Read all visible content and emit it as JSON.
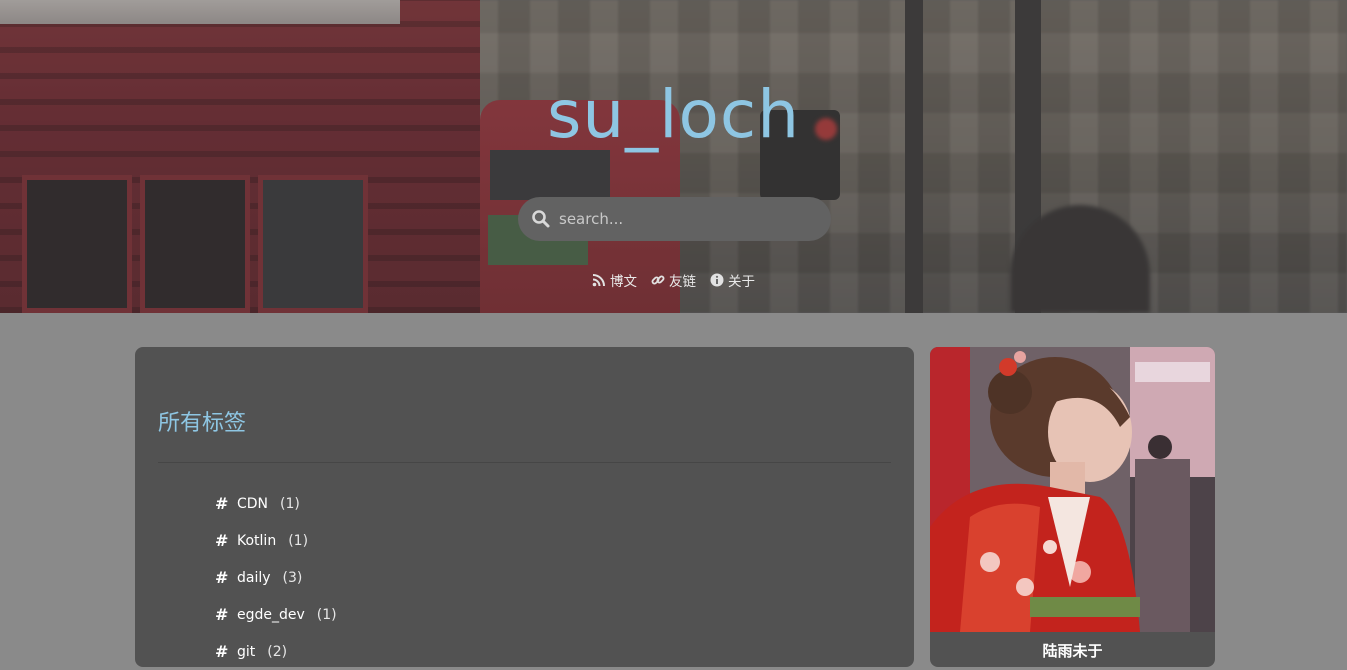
{
  "site": {
    "title": "su_loch"
  },
  "search": {
    "placeholder": "search..."
  },
  "nav": {
    "items": [
      {
        "label": "博文",
        "icon": "rss-icon"
      },
      {
        "label": "友链",
        "icon": "link-icon"
      },
      {
        "label": "关于",
        "icon": "info-icon"
      }
    ]
  },
  "main": {
    "heading": "所有标签",
    "tags": [
      {
        "name": "CDN",
        "count": "(1)"
      },
      {
        "name": "Kotlin",
        "count": "(1)"
      },
      {
        "name": "daily",
        "count": "(3)"
      },
      {
        "name": "egde_dev",
        "count": "(1)"
      },
      {
        "name": "git",
        "count": "(2)"
      }
    ]
  },
  "sidebar": {
    "profile_name": "陆雨未于"
  },
  "colors": {
    "accent": "#8ec6e3",
    "page_bg": "#8a8a8a",
    "card_bg": "#525252",
    "search_bg": "#626262"
  }
}
